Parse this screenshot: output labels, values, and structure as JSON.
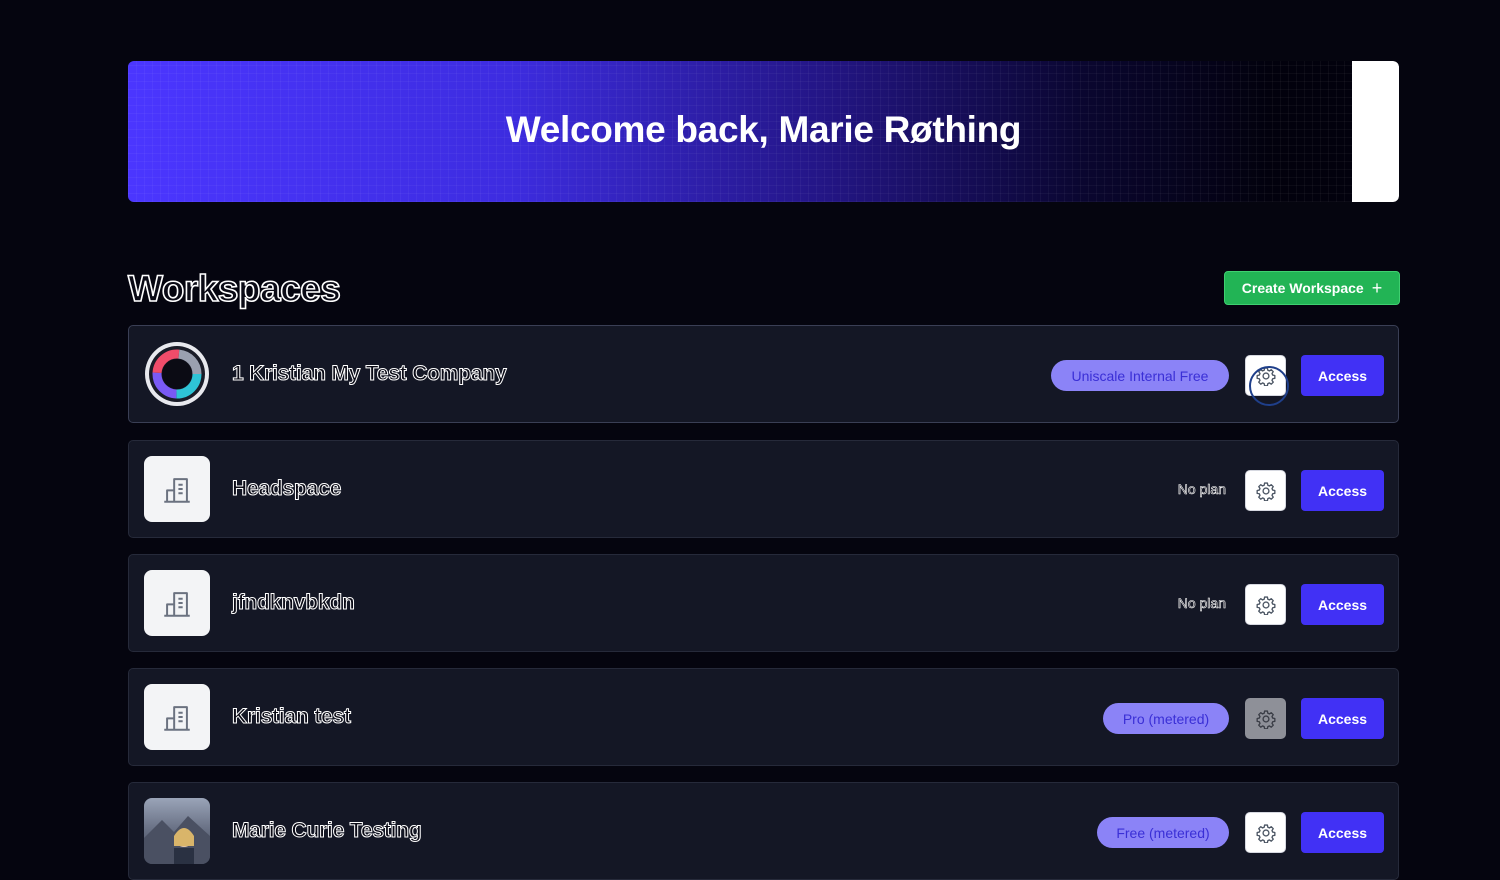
{
  "banner": {
    "title": "Welcome back, Marie Røthing"
  },
  "section": {
    "title": "Workspaces",
    "create_label": "Create Workspace",
    "create_icon": "plus-icon"
  },
  "workspaces": [
    {
      "name": "1 Kristian My Test Company",
      "plan": "Uniscale Internal Free",
      "plan_type": "badge",
      "avatar": "ring-logo",
      "access_label": "Access",
      "gear_state": "focused"
    },
    {
      "name": "Headspace",
      "plan": "No plan",
      "plan_type": "text",
      "avatar": "building-icon",
      "access_label": "Access",
      "gear_state": "normal"
    },
    {
      "name": "jfndknvbkdn",
      "plan": "No plan",
      "plan_type": "text",
      "avatar": "building-icon",
      "access_label": "Access",
      "gear_state": "normal"
    },
    {
      "name": "Kristian test",
      "plan": "Pro (metered)",
      "plan_type": "badge",
      "avatar": "building-icon",
      "access_label": "Access",
      "gear_state": "disabled"
    },
    {
      "name": "Marie Curie Testing",
      "plan": "Free (metered)",
      "plan_type": "badge",
      "avatar": "user-photo",
      "access_label": "Access",
      "gear_state": "normal"
    }
  ],
  "colors": {
    "background": "#05050f",
    "card": "#141725",
    "accent": "#4131f5",
    "create": "#22b455",
    "badge": "#8b83f7"
  }
}
